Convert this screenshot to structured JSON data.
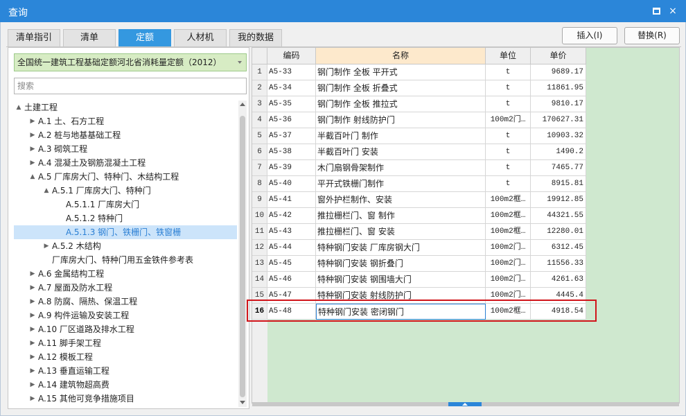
{
  "window": {
    "title": "查询",
    "maximize_icon": "maximize-icon",
    "close_icon": "close-icon",
    "close_glyph": "×"
  },
  "tabs": [
    {
      "label": "清单指引",
      "active": false
    },
    {
      "label": "清单",
      "active": false
    },
    {
      "label": "定额",
      "active": true
    },
    {
      "label": "人材机",
      "active": false
    },
    {
      "label": "我的数据",
      "active": false
    }
  ],
  "buttons": {
    "insert": "插入(I)",
    "replace": "替换(R)"
  },
  "quota_select": {
    "value": "全国统一建筑工程基础定额河北省消耗量定额（2012）"
  },
  "search": {
    "placeholder": "搜索"
  },
  "tree": [
    {
      "label": "土建工程",
      "toggle": "▲",
      "level": 0
    },
    {
      "label": "A.1 土、石方工程",
      "toggle": "▶",
      "level": 1
    },
    {
      "label": "A.2 桩与地基基础工程",
      "toggle": "▶",
      "level": 1
    },
    {
      "label": "A.3 砌筑工程",
      "toggle": "▶",
      "level": 1
    },
    {
      "label": "A.4 混凝土及钢筋混凝土工程",
      "toggle": "▶",
      "level": 1
    },
    {
      "label": "A.5 厂库房大门、特种门、木结构工程",
      "toggle": "▲",
      "level": 1
    },
    {
      "label": "A.5.1 厂库房大门、特种门",
      "toggle": "▲",
      "level": 2
    },
    {
      "label": "A.5.1.1 厂库房大门",
      "toggle": "",
      "level": 3
    },
    {
      "label": "A.5.1.2 特种门",
      "toggle": "",
      "level": 3
    },
    {
      "label": "A.5.1.3 钢门、铁栅门、铁窗栅",
      "toggle": "",
      "level": 3,
      "selected": true
    },
    {
      "label": "A.5.2 木结构",
      "toggle": "▶",
      "level": 2
    },
    {
      "label": "厂库房大门、特种门用五金铁件参考表",
      "toggle": "",
      "level": 2
    },
    {
      "label": "A.6 金属结构工程",
      "toggle": "▶",
      "level": 1
    },
    {
      "label": "A.7 屋面及防水工程",
      "toggle": "▶",
      "level": 1
    },
    {
      "label": "A.8 防腐、隔热、保温工程",
      "toggle": "▶",
      "level": 1
    },
    {
      "label": "A.9 构件运输及安装工程",
      "toggle": "▶",
      "level": 1
    },
    {
      "label": "A.10 厂区道路及排水工程",
      "toggle": "▶",
      "level": 1
    },
    {
      "label": "A.11 脚手架工程",
      "toggle": "▶",
      "level": 1
    },
    {
      "label": "A.12 模板工程",
      "toggle": "▶",
      "level": 1
    },
    {
      "label": "A.13 垂直运输工程",
      "toggle": "▶",
      "level": 1
    },
    {
      "label": "A.14 建筑物超高费",
      "toggle": "▶",
      "level": 1
    },
    {
      "label": "A.15 其他可竞争措施项目",
      "toggle": "▶",
      "level": 1
    }
  ],
  "table": {
    "columns": [
      "编码",
      "名称",
      "单位",
      "单价"
    ],
    "rows": [
      {
        "no": "1",
        "code": "A5-33",
        "name": "钢门制作 全板 平开式",
        "unit": "t",
        "price": "9689.17"
      },
      {
        "no": "2",
        "code": "A5-34",
        "name": "钢门制作 全板 折叠式",
        "unit": "t",
        "price": "11861.95"
      },
      {
        "no": "3",
        "code": "A5-35",
        "name": "钢门制作 全板 推拉式",
        "unit": "t",
        "price": "9810.17"
      },
      {
        "no": "4",
        "code": "A5-36",
        "name": "钢门制作 射线防护门",
        "unit": "100m2门…",
        "price": "170627.31"
      },
      {
        "no": "5",
        "code": "A5-37",
        "name": "半截百叶门 制作",
        "unit": "t",
        "price": "10903.32"
      },
      {
        "no": "6",
        "code": "A5-38",
        "name": "半截百叶门 安装",
        "unit": "t",
        "price": "1490.2"
      },
      {
        "no": "7",
        "code": "A5-39",
        "name": "木门扇钢骨架制作",
        "unit": "t",
        "price": "7465.77"
      },
      {
        "no": "8",
        "code": "A5-40",
        "name": "平开式铁栅门制作",
        "unit": "t",
        "price": "8915.81"
      },
      {
        "no": "9",
        "code": "A5-41",
        "name": "窗外护栏制作、安装",
        "unit": "100m2框…",
        "price": "19912.85"
      },
      {
        "no": "10",
        "code": "A5-42",
        "name": "推拉栅栏门、窗 制作",
        "unit": "100m2框…",
        "price": "44321.55"
      },
      {
        "no": "11",
        "code": "A5-43",
        "name": "推拉栅栏门、窗 安装",
        "unit": "100m2框…",
        "price": "12280.01"
      },
      {
        "no": "12",
        "code": "A5-44",
        "name": "特种钢门安装 厂库房钢大门",
        "unit": "100m2门…",
        "price": "6312.45"
      },
      {
        "no": "13",
        "code": "A5-45",
        "name": "特种钢门安装 钢折叠门",
        "unit": "100m2门…",
        "price": "11556.33"
      },
      {
        "no": "14",
        "code": "A5-46",
        "name": "特种钢门安装 钢围墙大门",
        "unit": "100m2门…",
        "price": "4261.63"
      },
      {
        "no": "15",
        "code": "A5-47",
        "name": "特种钢门安装 射线防护门",
        "unit": "100m2门…",
        "price": "4445.4"
      },
      {
        "no": "16",
        "code": "A5-48",
        "name": "特种钢门安装 密闭钢门",
        "unit": "100m2框…",
        "price": "4918.54",
        "current": true
      }
    ]
  },
  "colors": {
    "titlebar": "#2b86d9",
    "active_tab": "#3498e0",
    "selected_tree_bg": "#cce4fa",
    "grid_bg": "#cfe8cf",
    "name_header_bg": "#fde9cc",
    "highlight_border": "#d0141a"
  }
}
